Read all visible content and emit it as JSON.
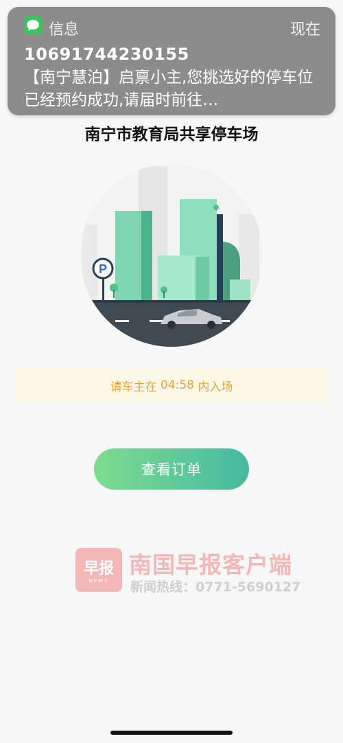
{
  "notification": {
    "app_name": "信息",
    "time": "现在",
    "sender": "10691744230155",
    "body": "【南宁慧泊】启禀小主,您挑选好的停车位已经预约成功,请届时前往…",
    "icon": "message-bubble-icon",
    "icon_color": "#34c759"
  },
  "page": {
    "title": "南宁市教育局共享停车场",
    "notice_prefix": "请车主在 ",
    "countdown": "04:58",
    "notice_suffix": " 内入场",
    "notice_color": "#e8a33c",
    "order_button": "查看订单",
    "illustration": "city-parking-illustration",
    "parking_sign": "P"
  },
  "watermark": {
    "logo": "早报",
    "logo_sub": "NEWS",
    "brand": "南国早报客户端",
    "hotline": "新闻热线：0771-5690127"
  }
}
